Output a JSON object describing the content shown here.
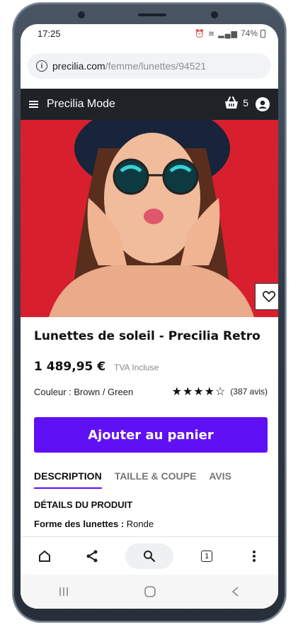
{
  "status_bar": {
    "time": "17:25",
    "battery": "74%"
  },
  "browser": {
    "url_domain": "precilia.com",
    "url_path": "/femme/lunettes/94521"
  },
  "site_header": {
    "site_name": "Precilia Mode",
    "cart_count": "5"
  },
  "product": {
    "title": "Lunettes de soleil - Precilia Retro",
    "price": "1 489,95 €",
    "tax_note": "TVA Incluse",
    "color_label": "Couleur : Brown / Green",
    "rating_stars": "★★★★☆",
    "rating_value": 4,
    "reviews": "(387 avis)",
    "add_to_cart": "Ajouter au panier"
  },
  "tabs": [
    {
      "label": "DESCRIPTION",
      "active": true
    },
    {
      "label": "TAILLE & COUPE",
      "active": false
    },
    {
      "label": "AVIS",
      "active": false
    }
  ],
  "details": {
    "section_title": "DÉTAILS DU PRODUIT",
    "shape_label": "Forme des lunettes :",
    "shape_value": " Ronde"
  },
  "toolbar": {
    "tab_count": "1"
  },
  "colors": {
    "accent": "#6010f5",
    "header_bg": "#1f2327",
    "hero_bg": "#d81f2e"
  },
  "icons": [
    "info-icon",
    "menu-icon",
    "cart-icon",
    "user-icon",
    "heart-icon",
    "home-icon",
    "share-icon",
    "search-icon",
    "tabs-icon",
    "more-icon",
    "recent-apps-icon",
    "android-home-icon",
    "back-icon"
  ]
}
